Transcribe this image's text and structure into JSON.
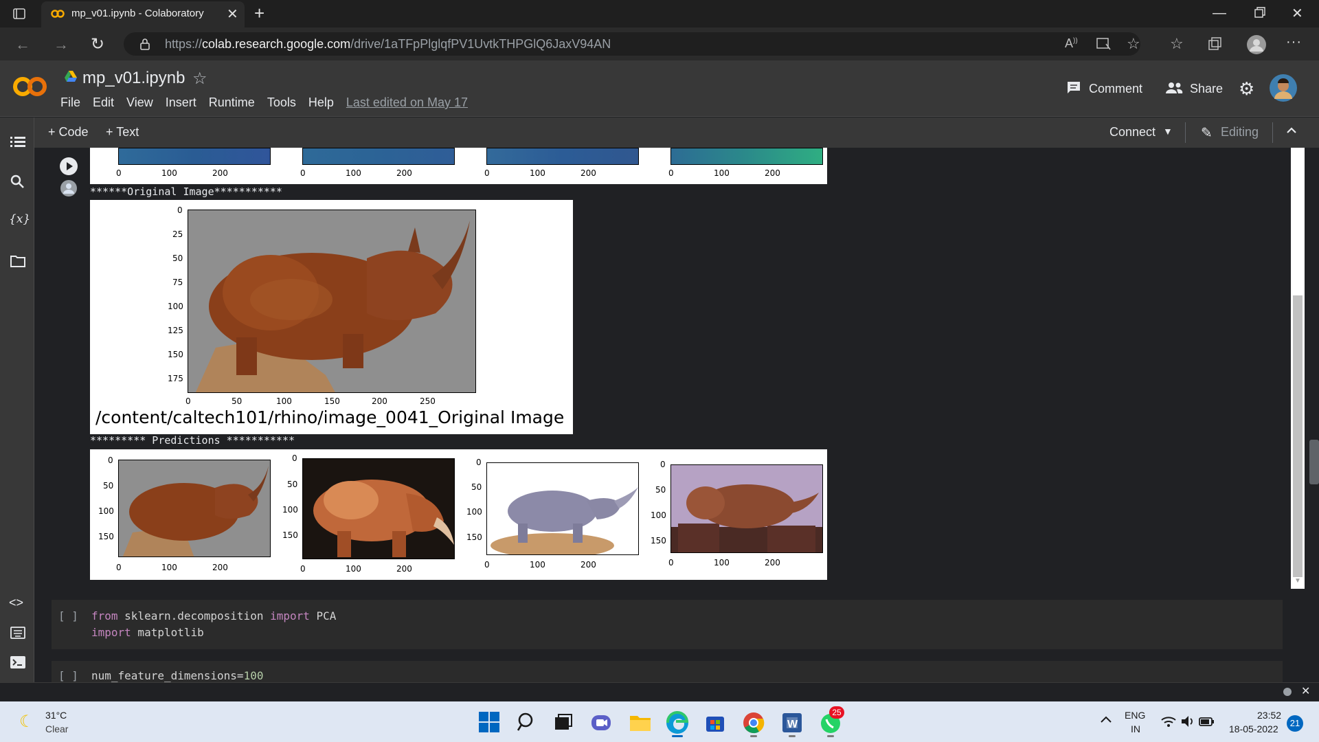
{
  "browser": {
    "tab_title": "mp_v01.ipynb - Colaboratory",
    "url_prefix": "https://",
    "url_host": "colab.research.google.com",
    "url_path": "/drive/1aTFpPlglqfPV1UvtkTHPGlQ6JaxV94AN"
  },
  "colab": {
    "logo": "CO",
    "notebook_name": "mp_v01.ipynb",
    "menu": [
      "File",
      "Edit",
      "View",
      "Insert",
      "Runtime",
      "Tools",
      "Help"
    ],
    "last_edited": "Last edited on May 17",
    "comment_label": "Comment",
    "share_label": "Share",
    "add_code_label": "+ Code",
    "add_text_label": "+ Text",
    "connect_label": "Connect",
    "editing_label": "Editing"
  },
  "output": {
    "top_row_ticks": [
      "0",
      "100",
      "200"
    ],
    "original_header": "******Original Image***********",
    "original_caption": "/content/caltech101/rhino/image_0041_Original Image",
    "original_y_ticks": [
      "0",
      "25",
      "50",
      "75",
      "100",
      "125",
      "150",
      "175"
    ],
    "original_x_ticks": [
      "0",
      "50",
      "100",
      "150",
      "200",
      "250"
    ],
    "predictions_header": "********* Predictions ***********",
    "pred_y_ticks": [
      "0",
      "50",
      "100",
      "150"
    ],
    "pred_x_ticks": [
      "0",
      "100",
      "200"
    ]
  },
  "cells": {
    "cell2_bracket": "[ ]",
    "cell2_line1": {
      "kw1": "from",
      "mod": " sklearn.decomposition ",
      "kw2": "import",
      "name": " PCA"
    },
    "cell2_line2": {
      "kw": "import",
      "mod": " matplotlib"
    },
    "cell3_bracket": "[ ]",
    "cell3_line": {
      "code": "num_feature_dimensions=",
      "num": "100"
    }
  },
  "taskbar": {
    "temp": "31°C",
    "weather": "Clear",
    "whatsapp_badge": "25",
    "lang1": "ENG",
    "lang2": "IN",
    "time": "23:52",
    "date": "18-05-2022",
    "notif_count": "21"
  }
}
